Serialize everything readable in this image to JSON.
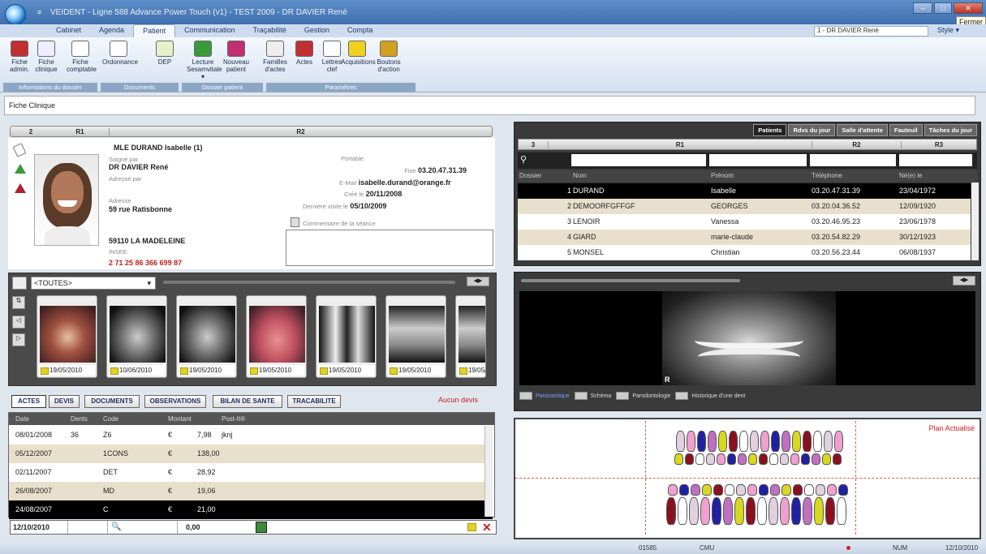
{
  "window": {
    "title": "VEIDENT - Ligne 588 Advance Power Touch (v1) - TEST 2009 - DR DAVIER René",
    "close_tooltip": "Fermer",
    "qat": "≡"
  },
  "menu": {
    "items": [
      "Cabinet",
      "Agenda",
      "Patient",
      "Communication",
      "Traçabilité",
      "Gestion",
      "Compta"
    ],
    "active": "Patient"
  },
  "topright": {
    "doctor": "1 - DR DAVIER René",
    "style": "Style"
  },
  "ribbon": {
    "buttons": [
      {
        "l1": "Fiche",
        "l2": "admin.",
        "icon": "admin-card-icon",
        "color": "#c03030"
      },
      {
        "l1": "Fiche",
        "l2": "clinique",
        "icon": "clinical-card-icon",
        "color": "#eef"
      },
      {
        "l1": "Fiche",
        "l2": "comptable",
        "icon": "euro-icon",
        "color": "#fff"
      },
      {
        "l1": "Ordonnance",
        "l2": "",
        "icon": "prescription-icon",
        "color": "#fff"
      },
      {
        "l1": "DEP",
        "l2": "",
        "icon": "dep-icon",
        "color": "#e8f0c8"
      },
      {
        "l1": "Lecture",
        "l2": "Sesamvitale ▾",
        "icon": "card-reader-icon",
        "color": "#3a9a3a"
      },
      {
        "l1": "Nouveau",
        "l2": "patient",
        "icon": "new-patient-icon",
        "color": "#c03070"
      },
      {
        "l1": "Familles",
        "l2": "d'actes",
        "icon": "families-icon",
        "color": "#eee"
      },
      {
        "l1": "Actes",
        "l2": "",
        "icon": "acts-icon",
        "color": "#c03030"
      },
      {
        "l1": "Lettres",
        "l2": "clef",
        "icon": "letter-key-icon",
        "color": "#fff"
      },
      {
        "l1": "Acquisitions",
        "l2": "",
        "icon": "acquisition-icon",
        "color": "#f0d020"
      },
      {
        "l1": "Boutons",
        "l2": "d'action",
        "icon": "action-buttons-icon",
        "color": "#d0a020"
      }
    ],
    "groups": [
      "Informations du dossier",
      "Documents",
      "Dossier patient",
      "Paramètres"
    ]
  },
  "page_title": "Fiche Clinique",
  "patient_header": {
    "num": "2",
    "r1": "R1",
    "r2": "R2"
  },
  "patient": {
    "name": "MLE DURAND Isabelle (1)",
    "soigne_label": "Soigné par",
    "soigne": "DR DAVIER René",
    "adresse_par_label": "Adressé par",
    "adresse_label": "Adresse",
    "adresse": "59 rue Ratisbonne",
    "ville": "59110  LA MADELEINE",
    "insee_label": "INSEE:",
    "insee": "2 71 25 86 366 699 87",
    "portable_label": "Portable",
    "fixe_label": "Fixe",
    "fixe": "03.20.47.31.39",
    "email_label": "E-Mail",
    "email": "isabelle.durand@orange.fr",
    "cree_label": "Créé le",
    "cree": "20/11/2008",
    "visite_label": "Dernière visite le",
    "visite": "05/10/2009",
    "comment_label": "Commentaire de la séance"
  },
  "images": {
    "filter": "<TOUTES>",
    "thumbs": [
      {
        "date": "19/05/2010",
        "type": "intraoral-photo"
      },
      {
        "date": "10/06/2010",
        "type": "panoramic-xray"
      },
      {
        "date": "19/05/2010",
        "type": "panoramic-xray"
      },
      {
        "date": "19/05/2010",
        "type": "mouth-photo"
      },
      {
        "date": "19/05/2010",
        "type": "bitewing-xray"
      },
      {
        "date": "19/05/2010",
        "type": "periapical-xray"
      },
      {
        "date": "19/05/2",
        "type": "periapical-xray"
      }
    ]
  },
  "tabs": [
    "ACTES",
    "DEVIS",
    "DOCUMENTS",
    "OBSERVATIONS",
    "BILAN DE SANTE",
    "TRACABILITE"
  ],
  "no_quote": "Aucun devis",
  "acts": {
    "headers": [
      "Date",
      "Dents",
      "Code",
      "Montant",
      "Post-It®"
    ],
    "rows": [
      {
        "date": "08/01/2008",
        "dents": "36",
        "code": "Z6",
        "cur": "€",
        "montant": "7,98",
        "postit": "jknj"
      },
      {
        "date": "05/12/2007",
        "dents": "",
        "code": "1CONS",
        "cur": "€",
        "montant": "138,00",
        "postit": ""
      },
      {
        "date": "02/11/2007",
        "dents": "",
        "code": "DET",
        "cur": "€",
        "montant": "28,92",
        "postit": ""
      },
      {
        "date": "26/08/2007",
        "dents": "",
        "code": "MD",
        "cur": "€",
        "montant": "19,06",
        "postit": ""
      },
      {
        "date": "24/08/2007",
        "dents": "",
        "code": "C",
        "cur": "€",
        "montant": "21,00",
        "postit": ""
      }
    ],
    "footer_date": "12/10/2010",
    "footer_amount": "0,00"
  },
  "patients_panel": {
    "tabs": [
      "Patients",
      "Rdvs du jour",
      "Salle d'attente",
      "Fauteuil",
      "Tâches du jour"
    ],
    "header": {
      "num": "3",
      "r1": "R1",
      "r2": "R2",
      "r3": "R3"
    },
    "columns": [
      "Dossier",
      "Nom",
      "Prénom",
      "Téléphone",
      "Né(e) le"
    ],
    "rows": [
      {
        "dossier": "1",
        "nom": "DURAND",
        "prenom": "Isabelle",
        "tel": "03.20.47.31.39",
        "ne": "23/04/1972"
      },
      {
        "dossier": "2",
        "nom": "DEMOORFGFFGF",
        "prenom": "GEORGES",
        "tel": "03.20.04.36.52",
        "ne": "12/09/1920"
      },
      {
        "dossier": "3",
        "nom": "LENOIR",
        "prenom": "Vanessa",
        "tel": "03.20.46.95.23",
        "ne": "23/06/1978"
      },
      {
        "dossier": "4",
        "nom": "GIARD",
        "prenom": "marie-claude",
        "tel": "03.20.54.82.29",
        "ne": "30/12/1923"
      },
      {
        "dossier": "5",
        "nom": "MONSEL",
        "prenom": "Christian",
        "tel": "03.20.56.23.44",
        "ne": "06/08/1937"
      }
    ]
  },
  "xray_panel": {
    "marker": "R",
    "tabs": [
      "Panoramique",
      "Schéma",
      "Parodontologie",
      "Historique d'une dent"
    ]
  },
  "dental_chart": {
    "label": "Plan Actualisé"
  },
  "status": {
    "code": "01585",
    "cmu": "CMU",
    "num": "NUM",
    "date": "12/10/2010"
  }
}
